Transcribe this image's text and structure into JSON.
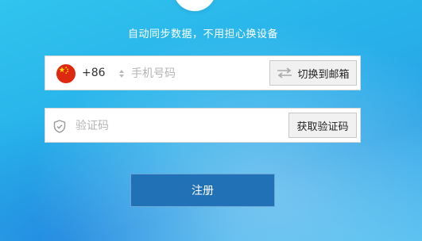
{
  "header": {
    "subtitle": "自动同步数据，不用担心换设备"
  },
  "phone_field": {
    "country_flag_icon": "china-flag-icon",
    "country_code": "+86",
    "placeholder": "手机号码",
    "switch_button_label": "切换到邮箱",
    "switch_icon": "swap-arrows-icon"
  },
  "code_field": {
    "icon": "shield-check-icon",
    "placeholder": "验证码",
    "get_code_button_label": "获取验证码"
  },
  "register_button": {
    "label": "注册"
  },
  "colors": {
    "register_button": "#2171b6",
    "background": "#2bb3ea"
  }
}
